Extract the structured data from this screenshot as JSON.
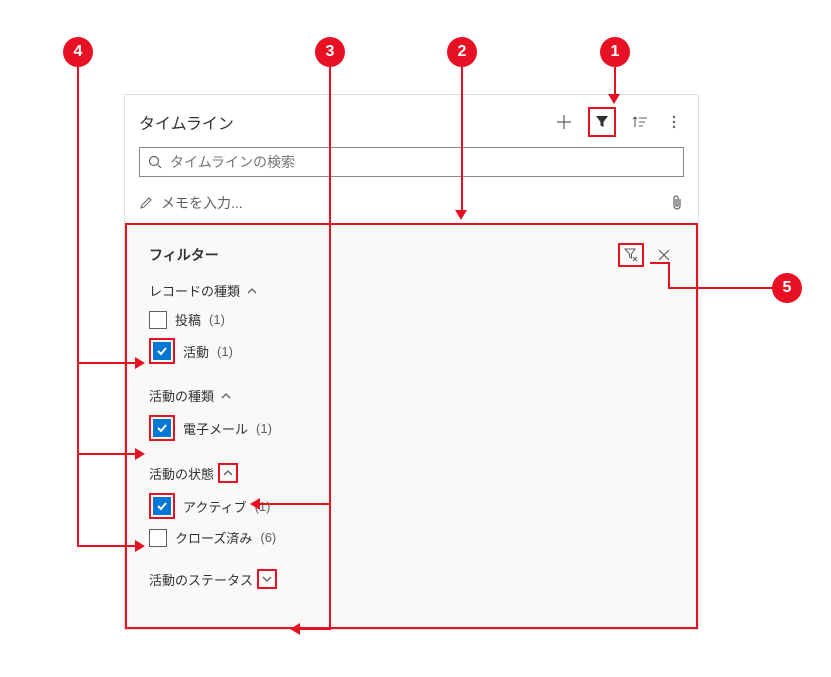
{
  "timeline": {
    "title": "タイムライン",
    "search_placeholder": "タイムラインの検索",
    "memo_placeholder": "メモを入力..."
  },
  "filter": {
    "title": "フィルター",
    "sections": {
      "record_type": {
        "label": "レコードの種類",
        "expanded": true
      },
      "activity_type": {
        "label": "活動の種類",
        "expanded": true
      },
      "activity_state": {
        "label": "活動の状態",
        "expanded": true
      },
      "activity_status": {
        "label": "活動のステータス",
        "expanded": false
      }
    },
    "items": {
      "post": {
        "label": "投稿",
        "count": "(1)",
        "checked": false
      },
      "activity": {
        "label": "活動",
        "count": "(1)",
        "checked": true
      },
      "email": {
        "label": "電子メール",
        "count": "(1)",
        "checked": true
      },
      "active": {
        "label": "アクティブ",
        "count": "(1)",
        "checked": true
      },
      "closed": {
        "label": "クローズ済み",
        "count": "(6)",
        "checked": false
      }
    }
  },
  "callouts": {
    "c1": "1",
    "c2": "2",
    "c3": "3",
    "c4": "4",
    "c5": "5"
  }
}
